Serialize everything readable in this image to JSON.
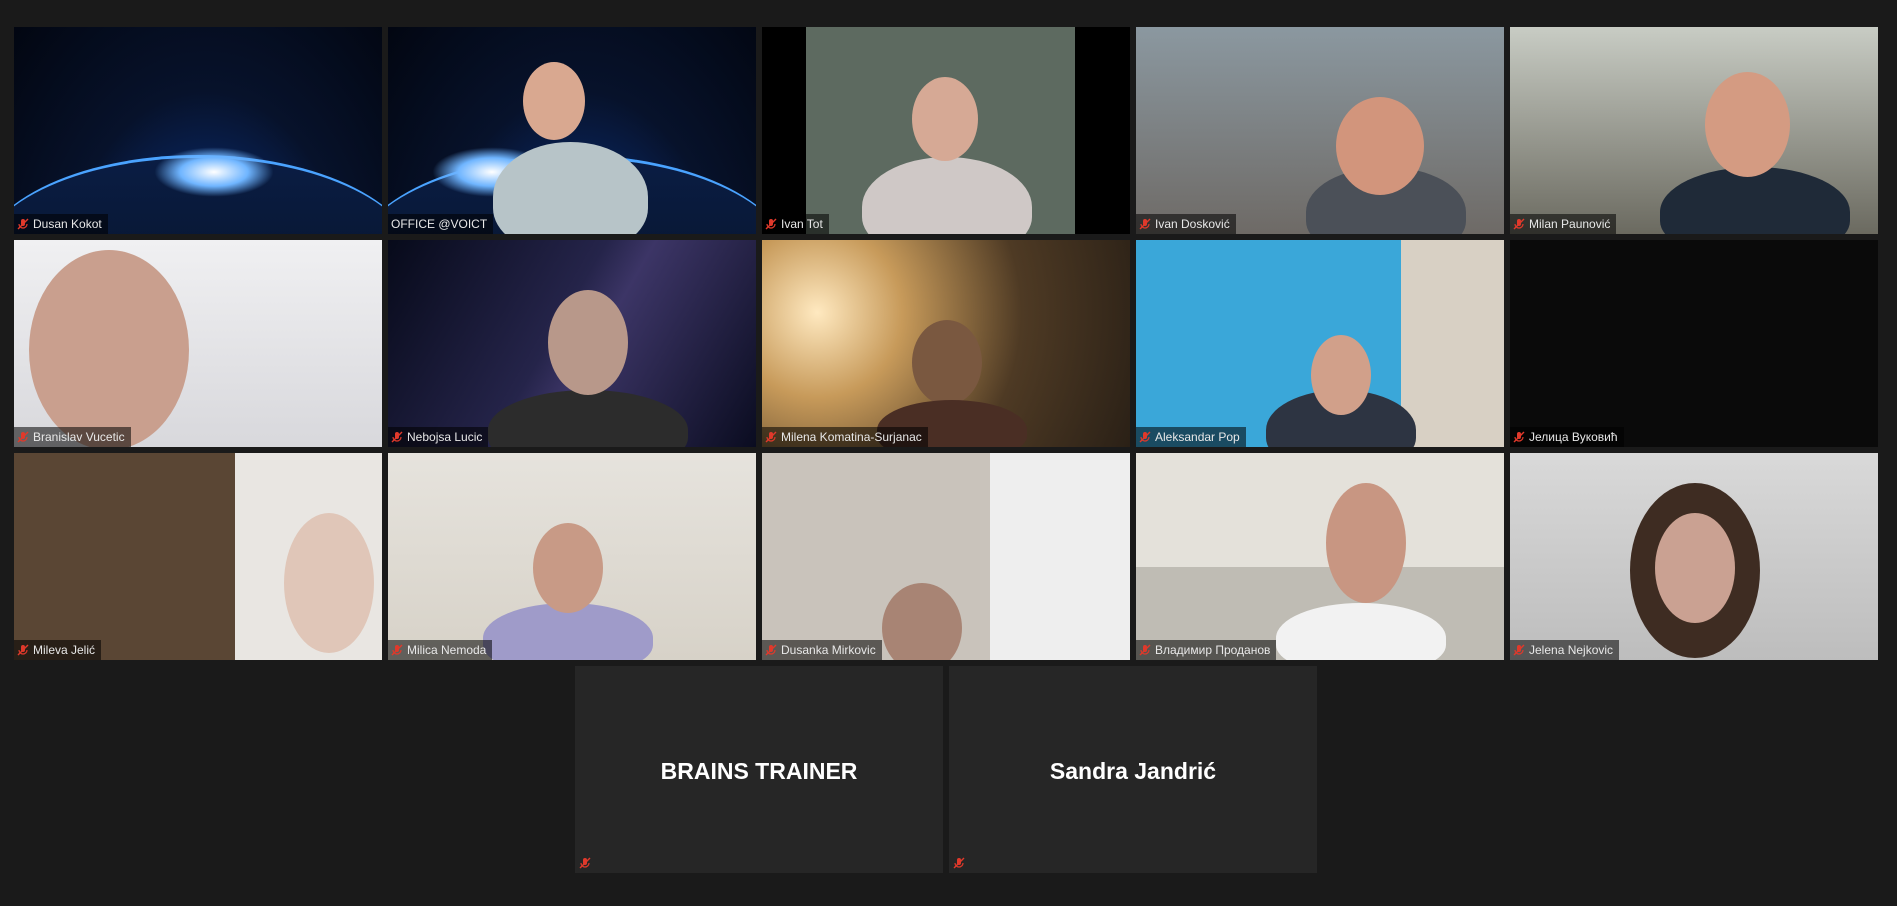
{
  "gallery": {
    "tiles": [
      {
        "name": "Dusan Kokot",
        "muted": true,
        "active": false,
        "background": "space"
      },
      {
        "name": "OFFICE @VOICT",
        "muted": false,
        "active": true,
        "background": "space"
      },
      {
        "name": "Ivan Tot",
        "muted": true,
        "active": false,
        "background": "teal"
      },
      {
        "name": "Ivan Dosković",
        "muted": true,
        "active": false,
        "background": "room"
      },
      {
        "name": "Milan Paunović",
        "muted": true,
        "active": false,
        "background": "room2"
      },
      {
        "name": "Branislav Vucetic",
        "muted": true,
        "active": false,
        "background": "wall"
      },
      {
        "name": "Nebojsa Lucic",
        "muted": true,
        "active": false,
        "background": "milky"
      },
      {
        "name": "Milena Komatina-Surjanac",
        "muted": true,
        "active": false,
        "background": "lamp"
      },
      {
        "name": "Aleksandar Pop",
        "muted": true,
        "active": false,
        "background": "blue"
      },
      {
        "name": "Јелица Вуковић",
        "muted": true,
        "active": false,
        "background": "dark"
      },
      {
        "name": "Mileva Jelić",
        "muted": true,
        "active": false,
        "background": "shelf"
      },
      {
        "name": "Milica Nemoda",
        "muted": true,
        "active": false,
        "background": "plain"
      },
      {
        "name": "Dusanka Mirkovic",
        "muted": true,
        "active": false,
        "background": "door"
      },
      {
        "name": "Владимир Проданов",
        "muted": true,
        "active": false,
        "background": "kitchen"
      },
      {
        "name": "Jelena Nejkovic",
        "muted": true,
        "active": false,
        "background": "grey"
      }
    ],
    "no_video_tiles": [
      {
        "name": "BRAINS TRAINER",
        "muted": true
      },
      {
        "name": "Sandra Jandrić",
        "muted": true
      }
    ]
  },
  "colors": {
    "background": "#1a1a1a",
    "active_speaker_border": "#cfe26b",
    "muted_icon": "#e0392b",
    "name_text": "#e8e8e8"
  },
  "icons": {
    "muted": "microphone-muted-icon"
  }
}
